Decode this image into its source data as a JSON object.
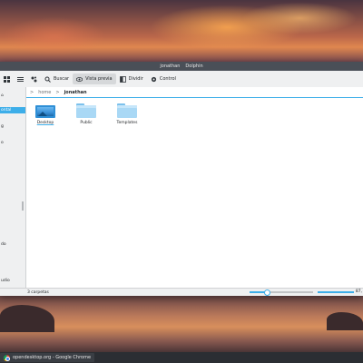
{
  "window": {
    "title_user": "jonathan",
    "title_app": "Dolphin"
  },
  "toolbar": {
    "search_label": "Buscar",
    "preview_label": "Vista previa",
    "split_label": "Dividir",
    "control_label": "Control"
  },
  "breadcrumb": {
    "separator": ">",
    "home": "home",
    "current": "jonathan"
  },
  "places": {
    "items": [
      "",
      "",
      "",
      "ontal",
      "g",
      "",
      "",
      "",
      "",
      "",
      "",
      "",
      "",
      "",
      "",
      "",
      "",
      "do",
      "",
      "",
      "",
      "udio"
    ]
  },
  "files": [
    {
      "name": "Desktop"
    },
    {
      "name": "Public"
    },
    {
      "name": "Templates"
    }
  ],
  "status": {
    "count": "3 carpetas",
    "free": "87,",
    "zoom_level": 0.27
  },
  "taskbar": {
    "task_label": "opendesktop.org - Google Chrome"
  },
  "colors": {
    "accent": "#3daee9",
    "titlebar": "#4a4f57",
    "taskbar": "#2b2e33"
  }
}
